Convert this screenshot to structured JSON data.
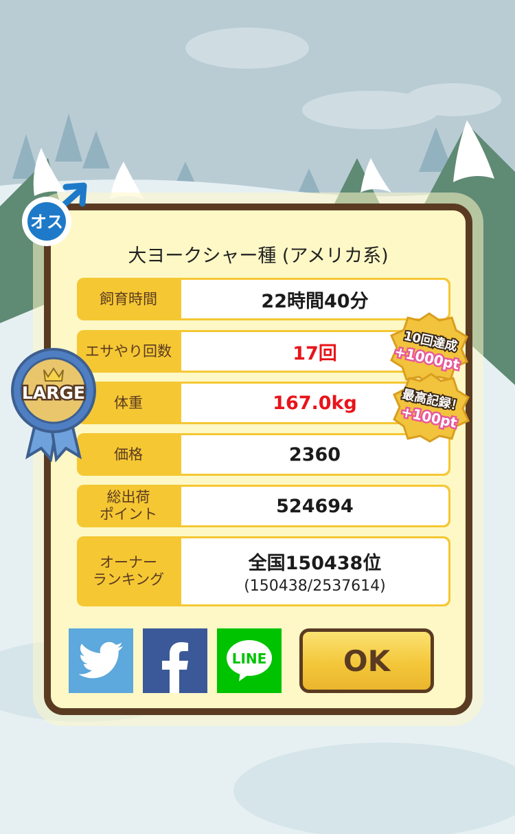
{
  "gender": {
    "label": "オス"
  },
  "breed_title": "大ヨークシャー種 (アメリカ系)",
  "stats": [
    {
      "label": "飼育時間",
      "value": "22時間40分"
    },
    {
      "label": "エサやり回数",
      "value": "17回"
    },
    {
      "label": "体重",
      "value": "167.0kg"
    },
    {
      "label": "価格",
      "value": "2360"
    },
    {
      "label": "総出荷\nポイント",
      "value": "524694"
    },
    {
      "label": "オーナー\nランキング",
      "value": "全国150438位",
      "sub": "(150438/2537614)"
    }
  ],
  "size_badge": {
    "label": "LARGE"
  },
  "bonus_badges": [
    {
      "line1": "10回達成",
      "line2": "+1000pt"
    },
    {
      "line1": "最高記録！",
      "line2": "+100pt"
    }
  ],
  "share": {
    "line_label": "LINE"
  },
  "ok_label": "OK",
  "colors": {
    "accent": "#f5c733",
    "border": "#5a3b22",
    "highlight": "#e8141b",
    "twitter": "#5da8dc",
    "facebook": "#3b5998",
    "line": "#00c300"
  }
}
